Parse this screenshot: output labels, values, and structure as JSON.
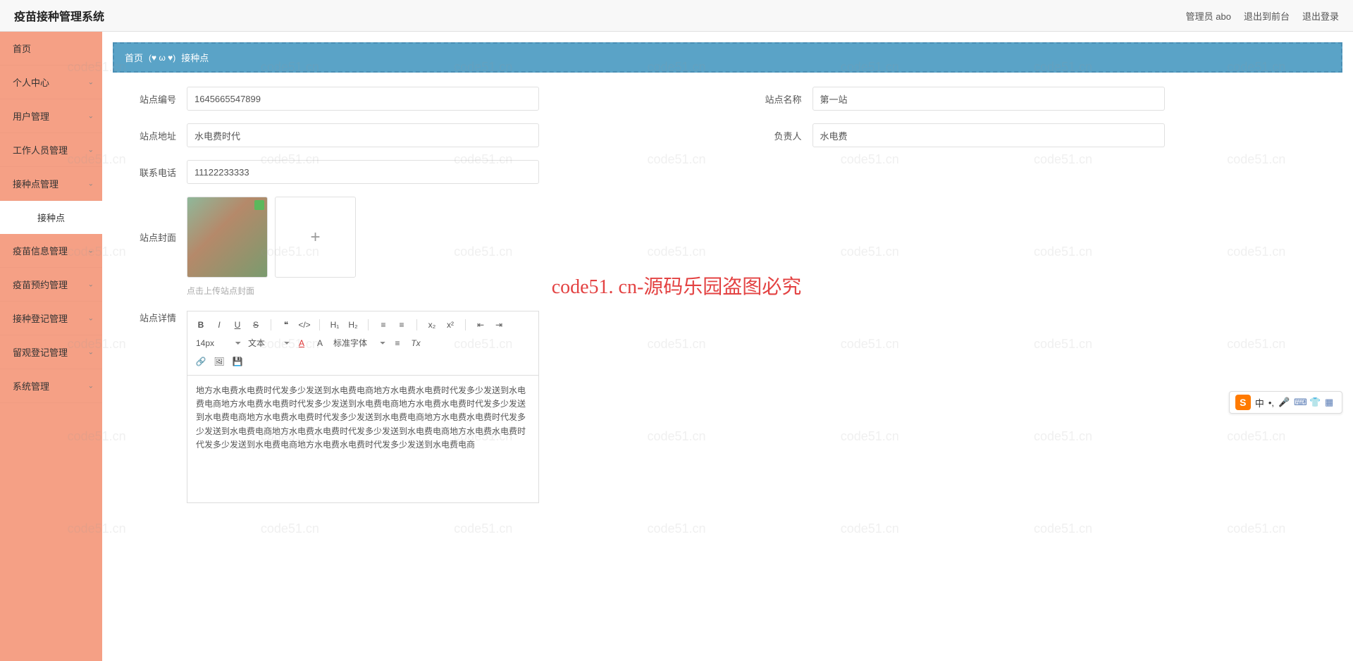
{
  "header": {
    "title": "疫苗接种管理系统",
    "admin": "管理员 abo",
    "frontend": "退出到前台",
    "logout": "退出登录"
  },
  "sidebar": {
    "items": [
      {
        "label": "首页",
        "sub": false
      },
      {
        "label": "个人中心",
        "sub": true
      },
      {
        "label": "用户管理",
        "sub": true
      },
      {
        "label": "工作人员管理",
        "sub": true
      },
      {
        "label": "接种点管理",
        "sub": true,
        "expanded": true,
        "child": "接种点"
      },
      {
        "label": "疫苗信息管理",
        "sub": true
      },
      {
        "label": "疫苗预约管理",
        "sub": true
      },
      {
        "label": "接种登记管理",
        "sub": true
      },
      {
        "label": "留观登记管理",
        "sub": true
      },
      {
        "label": "系统管理",
        "sub": true
      }
    ]
  },
  "breadcrumb": {
    "home": "首页",
    "heart": "(♥ ω ♥)",
    "page": "接种点"
  },
  "form": {
    "site_id": {
      "label": "站点编号",
      "value": "1645665547899"
    },
    "site_name": {
      "label": "站点名称",
      "value": "第一站"
    },
    "site_addr": {
      "label": "站点地址",
      "value": "水电费时代"
    },
    "owner": {
      "label": "负责人",
      "value": "水电费"
    },
    "phone": {
      "label": "联系电话",
      "value": "11122233333"
    },
    "cover": {
      "label": "站点封面",
      "hint": "点击上传站点封面"
    },
    "detail": {
      "label": "站点详情"
    }
  },
  "editor": {
    "fontsize": "14px",
    "para": "文本",
    "font": "标准字体",
    "content": "地方水电费水电费时代发多少发送到水电费电商地方水电费水电费时代发多少发送到水电费电商地方水电费水电费时代发多少发送到水电费电商地方水电费水电费时代发多少发送到水电费电商地方水电费水电费时代发多少发送到水电费电商地方水电费水电费时代发多少发送到水电费电商地方水电费水电费时代发多少发送到水电费电商地方水电费水电费时代发多少发送到水电费电商地方水电费水电费时代发多少发送到水电费电商"
  },
  "watermark": {
    "main": "code51. cn-源码乐园盗图必究",
    "bg": "code51.cn"
  },
  "ime": {
    "ch": "中"
  }
}
